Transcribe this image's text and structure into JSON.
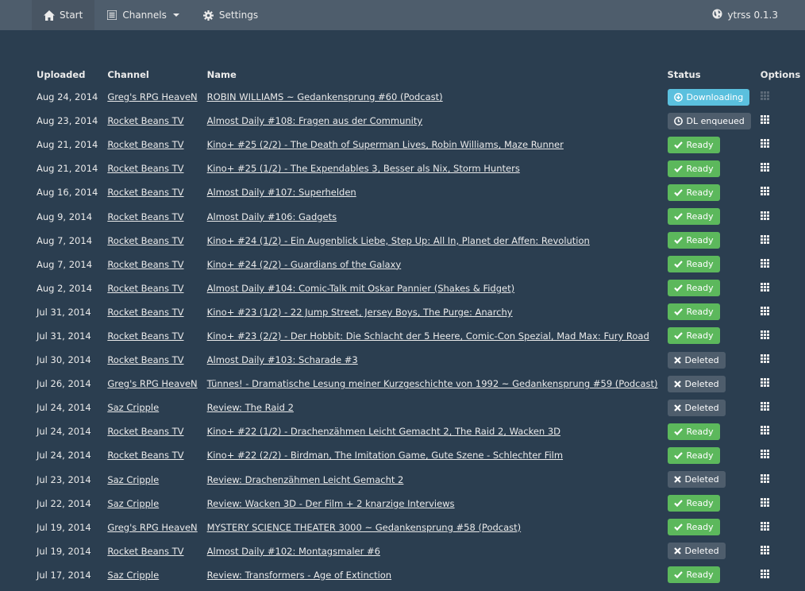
{
  "nav": {
    "start_label": "Start",
    "channels_label": "Channels",
    "settings_label": "Settings",
    "brand": "ytrss 0.1.3"
  },
  "columns": {
    "uploaded": "Uploaded",
    "channel": "Channel",
    "name": "Name",
    "status": "Status",
    "options": "Options"
  },
  "colors": {
    "background": "#2b3e50",
    "navbar": "#4e5d6c",
    "ready": "#5cb85c",
    "downloading": "#5bc0de",
    "grey_badge": "#4e5d6c"
  },
  "rows": [
    {
      "uploaded": "Aug 24, 2014",
      "channel": "Greg's RPG HeaveN",
      "name": "ROBIN WILLIAMS ~ Gedankensprung #60 (Podcast)",
      "status": "Downloading",
      "status_type": "downloading",
      "status_icon": "download-icon",
      "options_enabled": false
    },
    {
      "uploaded": "Aug 23, 2014",
      "channel": "Rocket Beans TV",
      "name": "Almost Daily #108: Fragen aus der Community",
      "status": "DL enqueued",
      "status_type": "enqueued",
      "status_icon": "clock-icon",
      "options_enabled": true
    },
    {
      "uploaded": "Aug 21, 2014",
      "channel": "Rocket Beans TV",
      "name": "Kino+ #25 (2/2) - The Death of Superman Lives, Robin Williams, Maze Runner",
      "status": "Ready",
      "status_type": "ready",
      "status_icon": "check-icon",
      "options_enabled": true
    },
    {
      "uploaded": "Aug 21, 2014",
      "channel": "Rocket Beans TV",
      "name": "Kino+ #25 (1/2) - The Expendables 3, Besser als Nix, Storm Hunters",
      "status": "Ready",
      "status_type": "ready",
      "status_icon": "check-icon",
      "options_enabled": true
    },
    {
      "uploaded": "Aug 16, 2014",
      "channel": "Rocket Beans TV",
      "name": "Almost Daily #107: Superhelden",
      "status": "Ready",
      "status_type": "ready",
      "status_icon": "check-icon",
      "options_enabled": true
    },
    {
      "uploaded": "Aug 9, 2014",
      "channel": "Rocket Beans TV",
      "name": "Almost Daily #106: Gadgets",
      "status": "Ready",
      "status_type": "ready",
      "status_icon": "check-icon",
      "options_enabled": true
    },
    {
      "uploaded": "Aug 7, 2014",
      "channel": "Rocket Beans TV",
      "name": "Kino+ #24 (1/2) - Ein Augenblick Liebe, Step Up: All In, Planet der Affen: Revolution",
      "status": "Ready",
      "status_type": "ready",
      "status_icon": "check-icon",
      "options_enabled": true
    },
    {
      "uploaded": "Aug 7, 2014",
      "channel": "Rocket Beans TV",
      "name": "Kino+ #24 (2/2) - Guardians of the Galaxy",
      "status": "Ready",
      "status_type": "ready",
      "status_icon": "check-icon",
      "options_enabled": true
    },
    {
      "uploaded": "Aug 2, 2014",
      "channel": "Rocket Beans TV",
      "name": "Almost Daily #104: Comic-Talk mit Oskar Pannier (Shakes & Fidget)",
      "status": "Ready",
      "status_type": "ready",
      "status_icon": "check-icon",
      "options_enabled": true
    },
    {
      "uploaded": "Jul 31, 2014",
      "channel": "Rocket Beans TV",
      "name": "Kino+ #23 (1/2) - 22 Jump Street, Jersey Boys, The Purge: Anarchy",
      "status": "Ready",
      "status_type": "ready",
      "status_icon": "check-icon",
      "options_enabled": true
    },
    {
      "uploaded": "Jul 31, 2014",
      "channel": "Rocket Beans TV",
      "name": "Kino+ #23 (2/2) - Der Hobbit: Die Schlacht der 5 Heere, Comic-Con Spezial, Mad Max: Fury Road",
      "status": "Ready",
      "status_type": "ready",
      "status_icon": "check-icon",
      "options_enabled": true
    },
    {
      "uploaded": "Jul 30, 2014",
      "channel": "Rocket Beans TV",
      "name": "Almost Daily #103: Scharade #3",
      "status": "Deleted",
      "status_type": "deleted",
      "status_icon": "x-icon",
      "options_enabled": true
    },
    {
      "uploaded": "Jul 26, 2014",
      "channel": "Greg's RPG HeaveN",
      "name": "Tünnes! - Dramatische Lesung meiner Kurzgeschichte von 1992 ~ Gedankensprung #59 (Podcast)",
      "status": "Deleted",
      "status_type": "deleted",
      "status_icon": "x-icon",
      "options_enabled": true
    },
    {
      "uploaded": "Jul 24, 2014",
      "channel": "Saz Cripple",
      "name": "Review: The Raid 2",
      "status": "Deleted",
      "status_type": "deleted",
      "status_icon": "x-icon",
      "options_enabled": true
    },
    {
      "uploaded": "Jul 24, 2014",
      "channel": "Rocket Beans TV",
      "name": "Kino+ #22 (1/2) - Drachenzähmen Leicht Gemacht 2, The Raid 2, Wacken 3D",
      "status": "Ready",
      "status_type": "ready",
      "status_icon": "check-icon",
      "options_enabled": true
    },
    {
      "uploaded": "Jul 24, 2014",
      "channel": "Rocket Beans TV",
      "name": "Kino+ #22 (2/2) - Birdman, The Imitation Game, Gute Szene - Schlechter Film",
      "status": "Ready",
      "status_type": "ready",
      "status_icon": "check-icon",
      "options_enabled": true
    },
    {
      "uploaded": "Jul 23, 2014",
      "channel": "Saz Cripple",
      "name": "Review: Drachenzähmen Leicht Gemacht 2",
      "status": "Deleted",
      "status_type": "deleted",
      "status_icon": "x-icon",
      "options_enabled": true
    },
    {
      "uploaded": "Jul 22, 2014",
      "channel": "Saz Cripple",
      "name": "Review: Wacken 3D - Der Film + 2 knarzige Interviews",
      "status": "Ready",
      "status_type": "ready",
      "status_icon": "check-icon",
      "options_enabled": true
    },
    {
      "uploaded": "Jul 19, 2014",
      "channel": "Greg's RPG HeaveN",
      "name": "MYSTERY SCIENCE THEATER 3000 ~ Gedankensprung #58 (Podcast)",
      "status": "Ready",
      "status_type": "ready",
      "status_icon": "check-icon",
      "options_enabled": true
    },
    {
      "uploaded": "Jul 19, 2014",
      "channel": "Rocket Beans TV",
      "name": "Almost Daily #102: Montagsmaler #6",
      "status": "Deleted",
      "status_type": "deleted",
      "status_icon": "x-icon",
      "options_enabled": true
    },
    {
      "uploaded": "Jul 17, 2014",
      "channel": "Saz Cripple",
      "name": "Review: Transformers - Age of Extinction",
      "status": "Ready",
      "status_type": "ready",
      "status_icon": "check-icon",
      "options_enabled": true
    }
  ]
}
